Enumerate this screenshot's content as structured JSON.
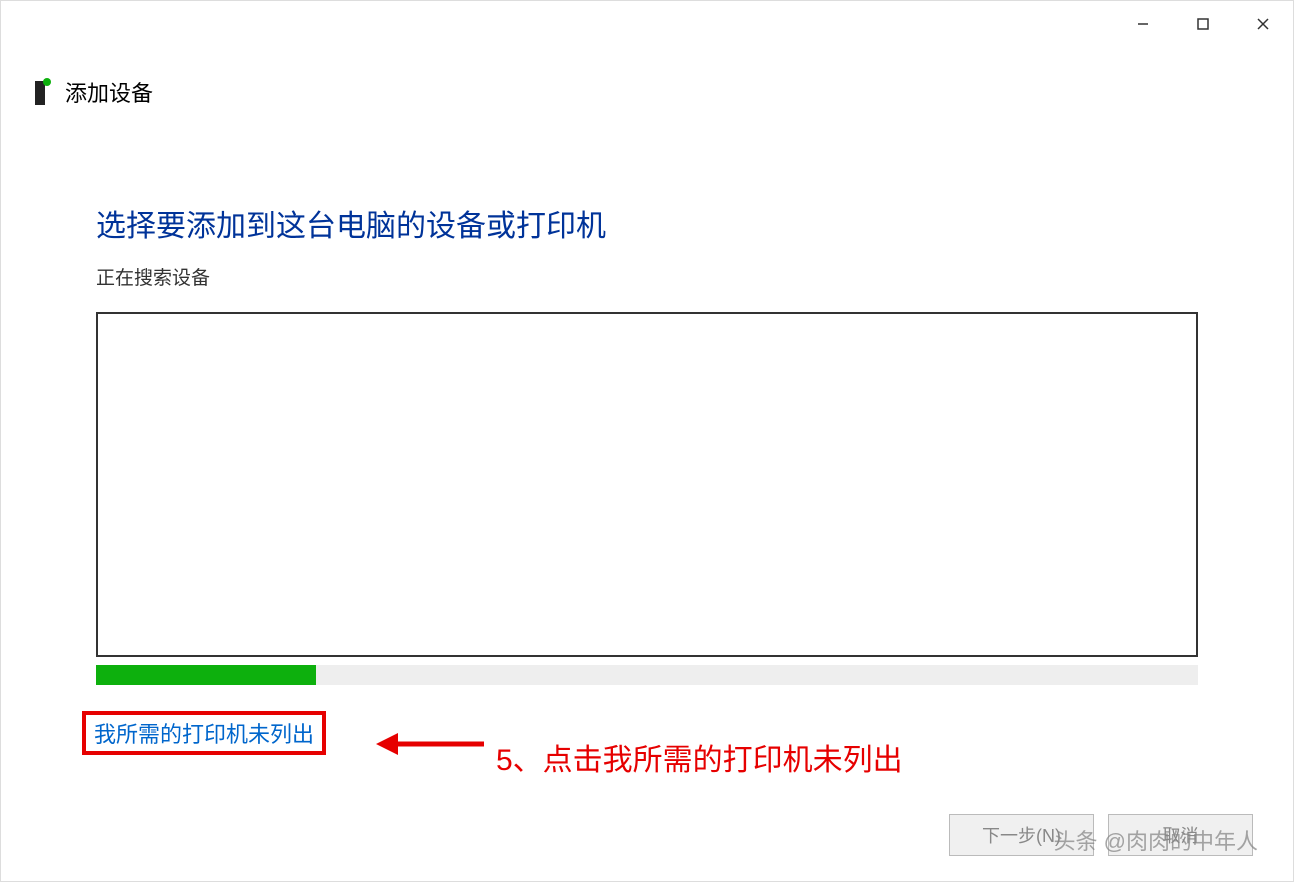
{
  "window": {
    "title": "添加设备"
  },
  "content": {
    "heading": "选择要添加到这台电脑的设备或打印机",
    "status": "正在搜索设备",
    "progress_percent": 20
  },
  "link": {
    "not_listed": "我所需的打印机未列出"
  },
  "annotation": {
    "text": "5、点击我所需的打印机未列出"
  },
  "buttons": {
    "next": "下一步(N)",
    "cancel": "取消"
  },
  "watermark": "头条 @肉肉的中年人"
}
